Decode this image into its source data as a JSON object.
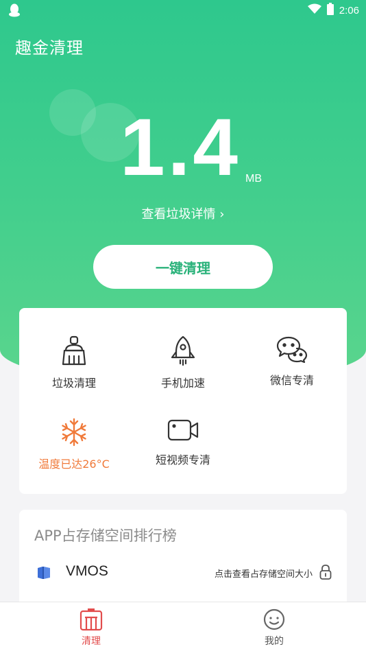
{
  "status_bar": {
    "time": "2:06",
    "left_icon": "qq-penguin-icon",
    "wifi_icon": "wifi-icon",
    "battery_icon": "battery-icon"
  },
  "app": {
    "title": "趣金清理"
  },
  "junk": {
    "size_value": "1.4",
    "size_unit": "MB",
    "detail_link": "查看垃圾详情 ›"
  },
  "clean_button": {
    "label": "一键清理"
  },
  "tools": [
    {
      "label": "垃圾清理",
      "icon": "broom-icon"
    },
    {
      "label": "手机加速",
      "icon": "rocket-icon"
    },
    {
      "label": "微信专清",
      "icon": "wechat-icon"
    },
    {
      "label": "温度已达26°C",
      "icon": "snowflake-icon"
    },
    {
      "label": "短视频专清",
      "icon": "video-camera-icon"
    }
  ],
  "ranking": {
    "title": "APP占存储空间排行榜",
    "items": [
      {
        "name": "VMOS",
        "hint": "点击查看占存储空间大小",
        "icon": "vmos-app-icon"
      }
    ]
  },
  "tabbar": {
    "tabs": [
      {
        "label": "清理",
        "icon": "clean-tab-icon",
        "active": true
      },
      {
        "label": "我的",
        "icon": "profile-face-icon",
        "active": false
      }
    ]
  },
  "colors": {
    "brand_green": "#2ec88d",
    "button_text_green": "#2ab27a",
    "warn_orange": "#f07a3a",
    "active_tab_red": "#e24c4c"
  }
}
